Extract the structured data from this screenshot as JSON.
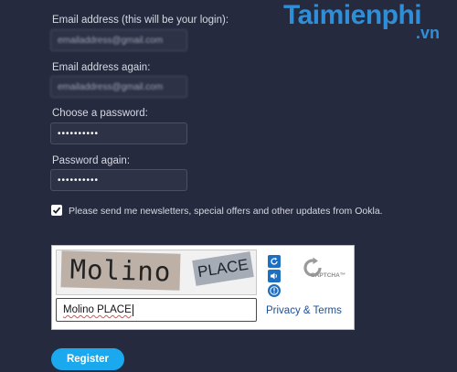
{
  "watermark": {
    "brand": "Taimienphi",
    "suffix": ".vn"
  },
  "form": {
    "email_label": "Email address (this will be your login):",
    "email_value": "emailaddress@gmail.com",
    "email_again_label": "Email address again:",
    "email_again_value": "emailaddress@gmail.com",
    "password_label": "Choose a password:",
    "password_value": "••••••••••",
    "password_again_label": "Password again:",
    "password_again_value": "••••••••••",
    "newsletter_label": "Please send me newsletters, special offers and other updates from Ookla.",
    "newsletter_checked": true
  },
  "captcha": {
    "word1": "Molino",
    "word2": "PLACE",
    "response_value": "Molino PLACE",
    "privacy_link": "Privacy & Terms",
    "logo_text": "CAPTCHA™",
    "icons": [
      "refresh-icon",
      "audio-icon",
      "help-icon"
    ]
  },
  "register_button": "Register",
  "colors": {
    "background": "#262a3e",
    "button": "#1aa9ef",
    "link": "#1a4f9e"
  }
}
